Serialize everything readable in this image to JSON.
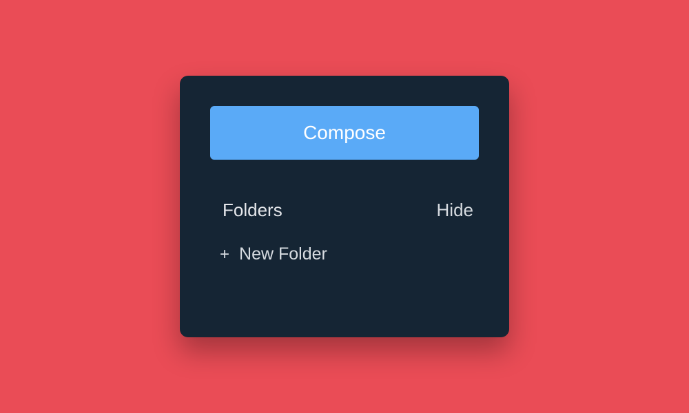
{
  "panel": {
    "compose_label": "Compose",
    "folders_header_label": "Folders",
    "hide_label": "Hide",
    "new_folder_label": "New Folder",
    "plus_icon": "+"
  }
}
